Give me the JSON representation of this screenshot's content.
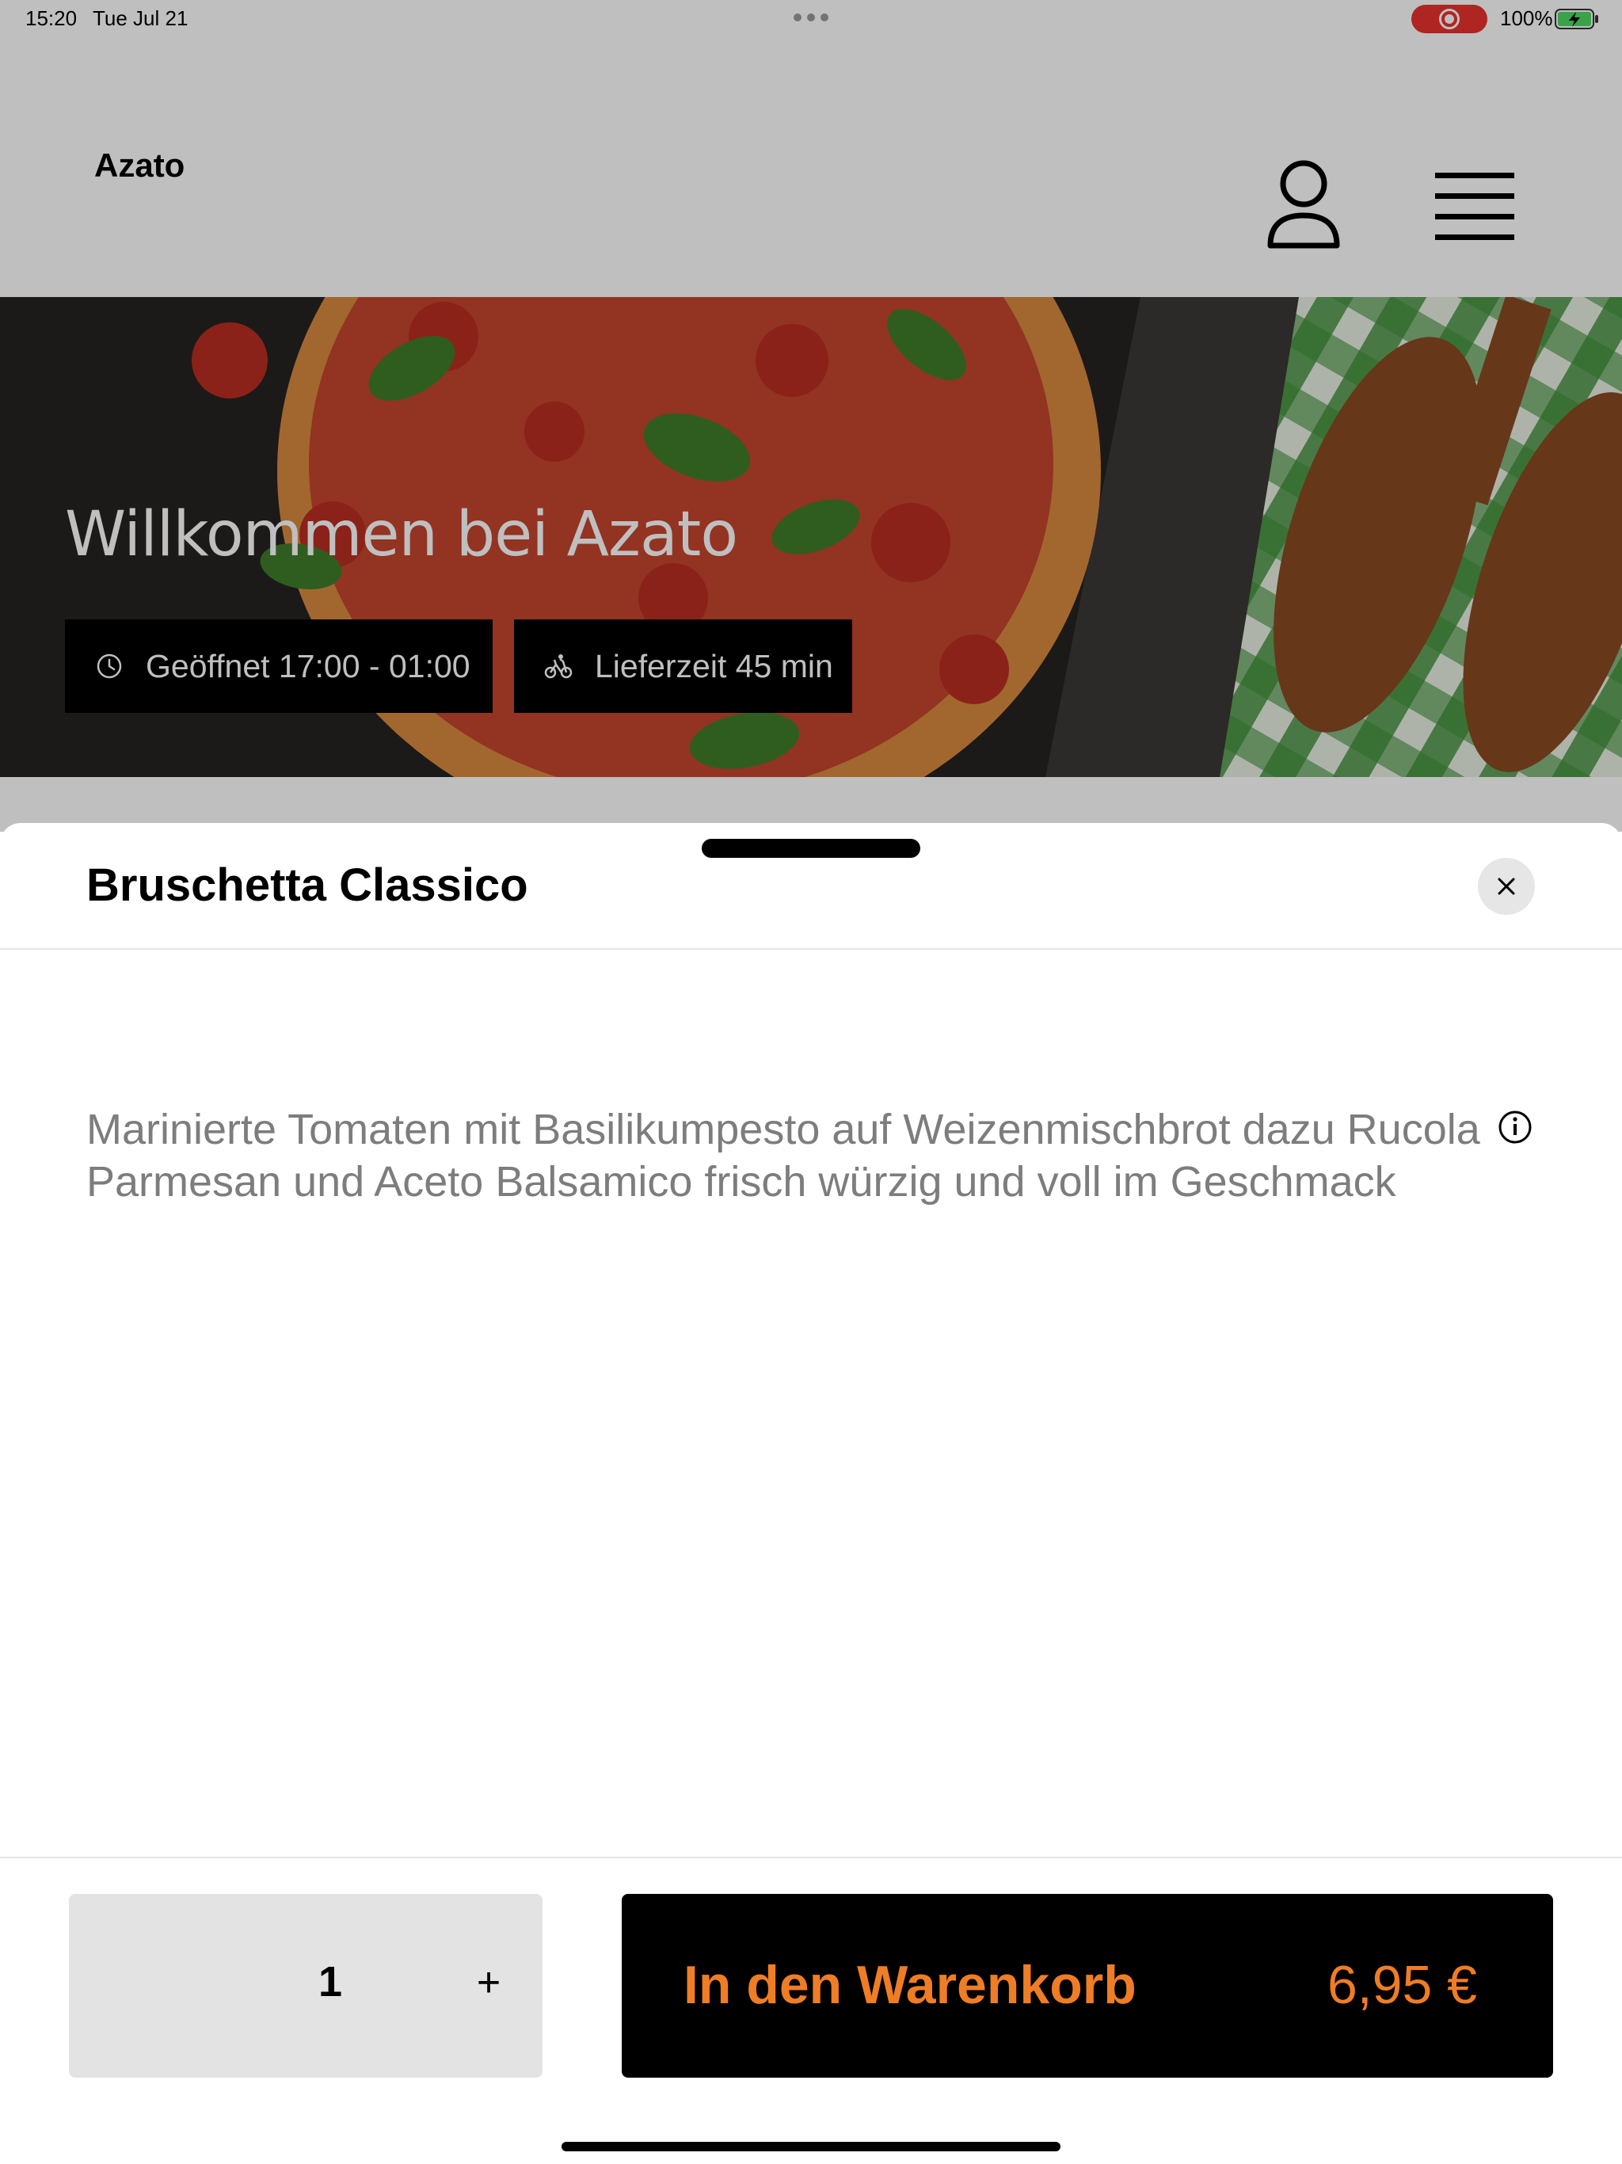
{
  "status_bar": {
    "time": "15:20",
    "date": "Tue Jul 21",
    "battery": "100%"
  },
  "header": {
    "brand": "Azato",
    "account_icon": "person-icon",
    "menu_icon": "hamburger-menu-icon"
  },
  "hero": {
    "title": "Willkommen bei Azato",
    "opening_hours": "Geöffnet 17:00 - 01:00",
    "delivery_time": "Lieferzeit 45 min",
    "clock_icon": "clock-icon",
    "delivery_icon": "bicycle-icon"
  },
  "sheet": {
    "title": "Bruschetta Classico",
    "description": "Marinierte Tomaten mit Basilikumpesto auf Weizenmischbrot dazu Rucola Parmesan und Aceto Balsamico frisch würzig und voll im Geschmack",
    "close_icon": "close-icon",
    "info_icon": "info-icon"
  },
  "footer": {
    "quantity": "1",
    "plus": "+",
    "add_to_cart": "In den Warenkorb",
    "price": "6,95 €"
  },
  "colors": {
    "accent": "#ef7d25",
    "record": "#e8322c",
    "battery": "#4cd964"
  }
}
